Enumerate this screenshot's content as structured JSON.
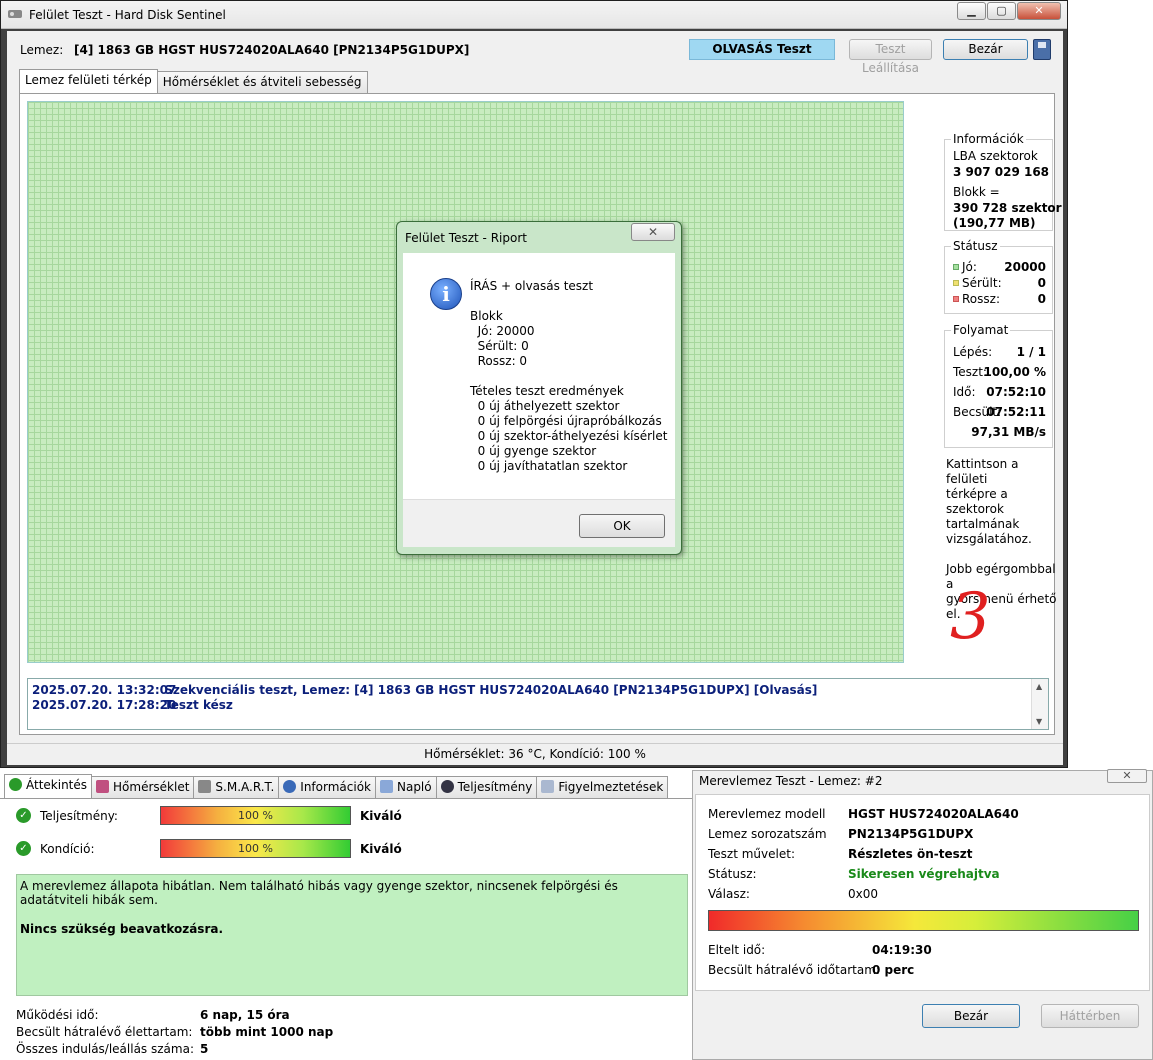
{
  "main_window": {
    "title": "Felület Teszt - Hard Disk Sentinel",
    "disk_label": "Lemez:",
    "disk_name": "[4] 1863 GB  HGST HUS724020ALA640 [PN2134P5G1DUPX]",
    "status_pill": "OLVASÁS Teszt",
    "stop_button": "Teszt Leállítása",
    "close_button": "Bezár",
    "tabs": [
      "Lemez felületi térkép",
      "Hőmérséklet és átviteli sebesség"
    ],
    "log": [
      {
        "ts": "2025.07.20.  13:32:07",
        "msg": "Szekvenciális teszt, Lemez: [4] 1863 GB  HGST HUS724020ALA640 [PN2134P5G1DUPX] [Olvasás]"
      },
      {
        "ts": "2025.07.20.  17:28:20",
        "msg": "Teszt kész"
      }
    ],
    "statusbar": "Hőmérséklet: 36  °C,  Kondíció: 100 %"
  },
  "info_panel": {
    "info_header": "Információk",
    "lba_label": "LBA szektorok",
    "lba_value": "3 907 029 168",
    "block_label": "Blokk =",
    "block_value": "390 728 szektor",
    "block_size": "(190,77 MB)",
    "status_header": "Státusz",
    "good_label": "Jó:",
    "good_value": "20000",
    "damaged_label": "Sérült:",
    "damaged_value": "0",
    "bad_label": "Rossz:",
    "bad_value": "0",
    "progress_header": "Folyamat",
    "step_label": "Lépés:",
    "step_value": "1 / 1",
    "test_label": "Teszt:",
    "test_value": "100,00 %",
    "time_label": "Idő:",
    "time_value": "07:52:10",
    "est_label": "Becsült:",
    "est_value": "07:52:11",
    "speed_value": "97,31 MB/s",
    "help1": [
      "Kattintson a felületi",
      "térképre a szektorok",
      "tartalmának",
      "vizsgálatához."
    ],
    "help2": [
      "Jobb egérgombbal a",
      "gyorsmenü érhető",
      "el."
    ],
    "colors": {
      "good": "#a6e0a0",
      "damaged": "#f0e070",
      "bad": "#f08080"
    }
  },
  "report_dialog": {
    "title": "Felület Teszt - Riport",
    "close_glyph": "✕",
    "heading": "ÍRÁS + olvasás teszt",
    "block_label": "Blokk",
    "good": "  Jó: 20000",
    "damaged": "  Sérült: 0",
    "bad": "  Rossz: 0",
    "detail_header": "Tételes teszt eredmények",
    "details": [
      "  0 új áthelyezett szektor",
      "  0 új felpörgési újrapróbálkozás",
      "  0 új szektor-áthelyezési kísérlet",
      "  0 új gyenge szektor",
      "  0 új javíthatatlan szektor"
    ],
    "ok_button": "OK"
  },
  "handwritten_mark": "3",
  "overview": {
    "tabs": [
      "Áttekintés",
      "Hőmérséklet",
      "S.M.A.R.T.",
      "Információk",
      "Napló",
      "Teljesítmény",
      "Figyelmeztetések"
    ],
    "performance_label": "Teljesítmény:",
    "performance_value": "100 %",
    "performance_percent": 100,
    "performance_rating": "Kiváló",
    "condition_label": "Kondíció:",
    "condition_value": "100 %",
    "condition_percent": 100,
    "condition_rating": "Kiváló",
    "message": "A merevlemez állapota hibátlan. Nem található hibás vagy gyenge szektor, nincsenek felpörgési és adatátviteli hibák sem.",
    "message_bold": "Nincs szükség beavatkozásra.",
    "uptime_label": "Működési idő:",
    "uptime_value": "6 nap, 15 óra",
    "lifetime_label": "Becsült hátralévő élettartam:",
    "lifetime_value": "több mint 1000 nap",
    "starts_label": "Összes indulás/leállás száma:",
    "starts_value": "5"
  },
  "selftest_dialog": {
    "title": "Merevlemez Teszt - Lemez: #2",
    "close_glyph": "✕",
    "model_label": "Merevlemez modell",
    "model_value": "HGST HUS724020ALA640",
    "serial_label": "Lemez sorozatszám",
    "serial_value": "PN2134P5G1DUPX",
    "op_label": "Teszt művelet:",
    "op_value": "Részletes ön-teszt",
    "status_label": "Státusz:",
    "status_value": "Sikeresen végrehajtva",
    "response_label": "Válasz:",
    "response_value": "0x00",
    "progress_percent": 100,
    "elapsed_label": "Eltelt idő:",
    "elapsed_value": "04:19:30",
    "remaining_label": "Becsült hátralévő időtartam:",
    "remaining_value": "0 perc",
    "close_button": "Bezár",
    "background_button": "Háttérben"
  }
}
